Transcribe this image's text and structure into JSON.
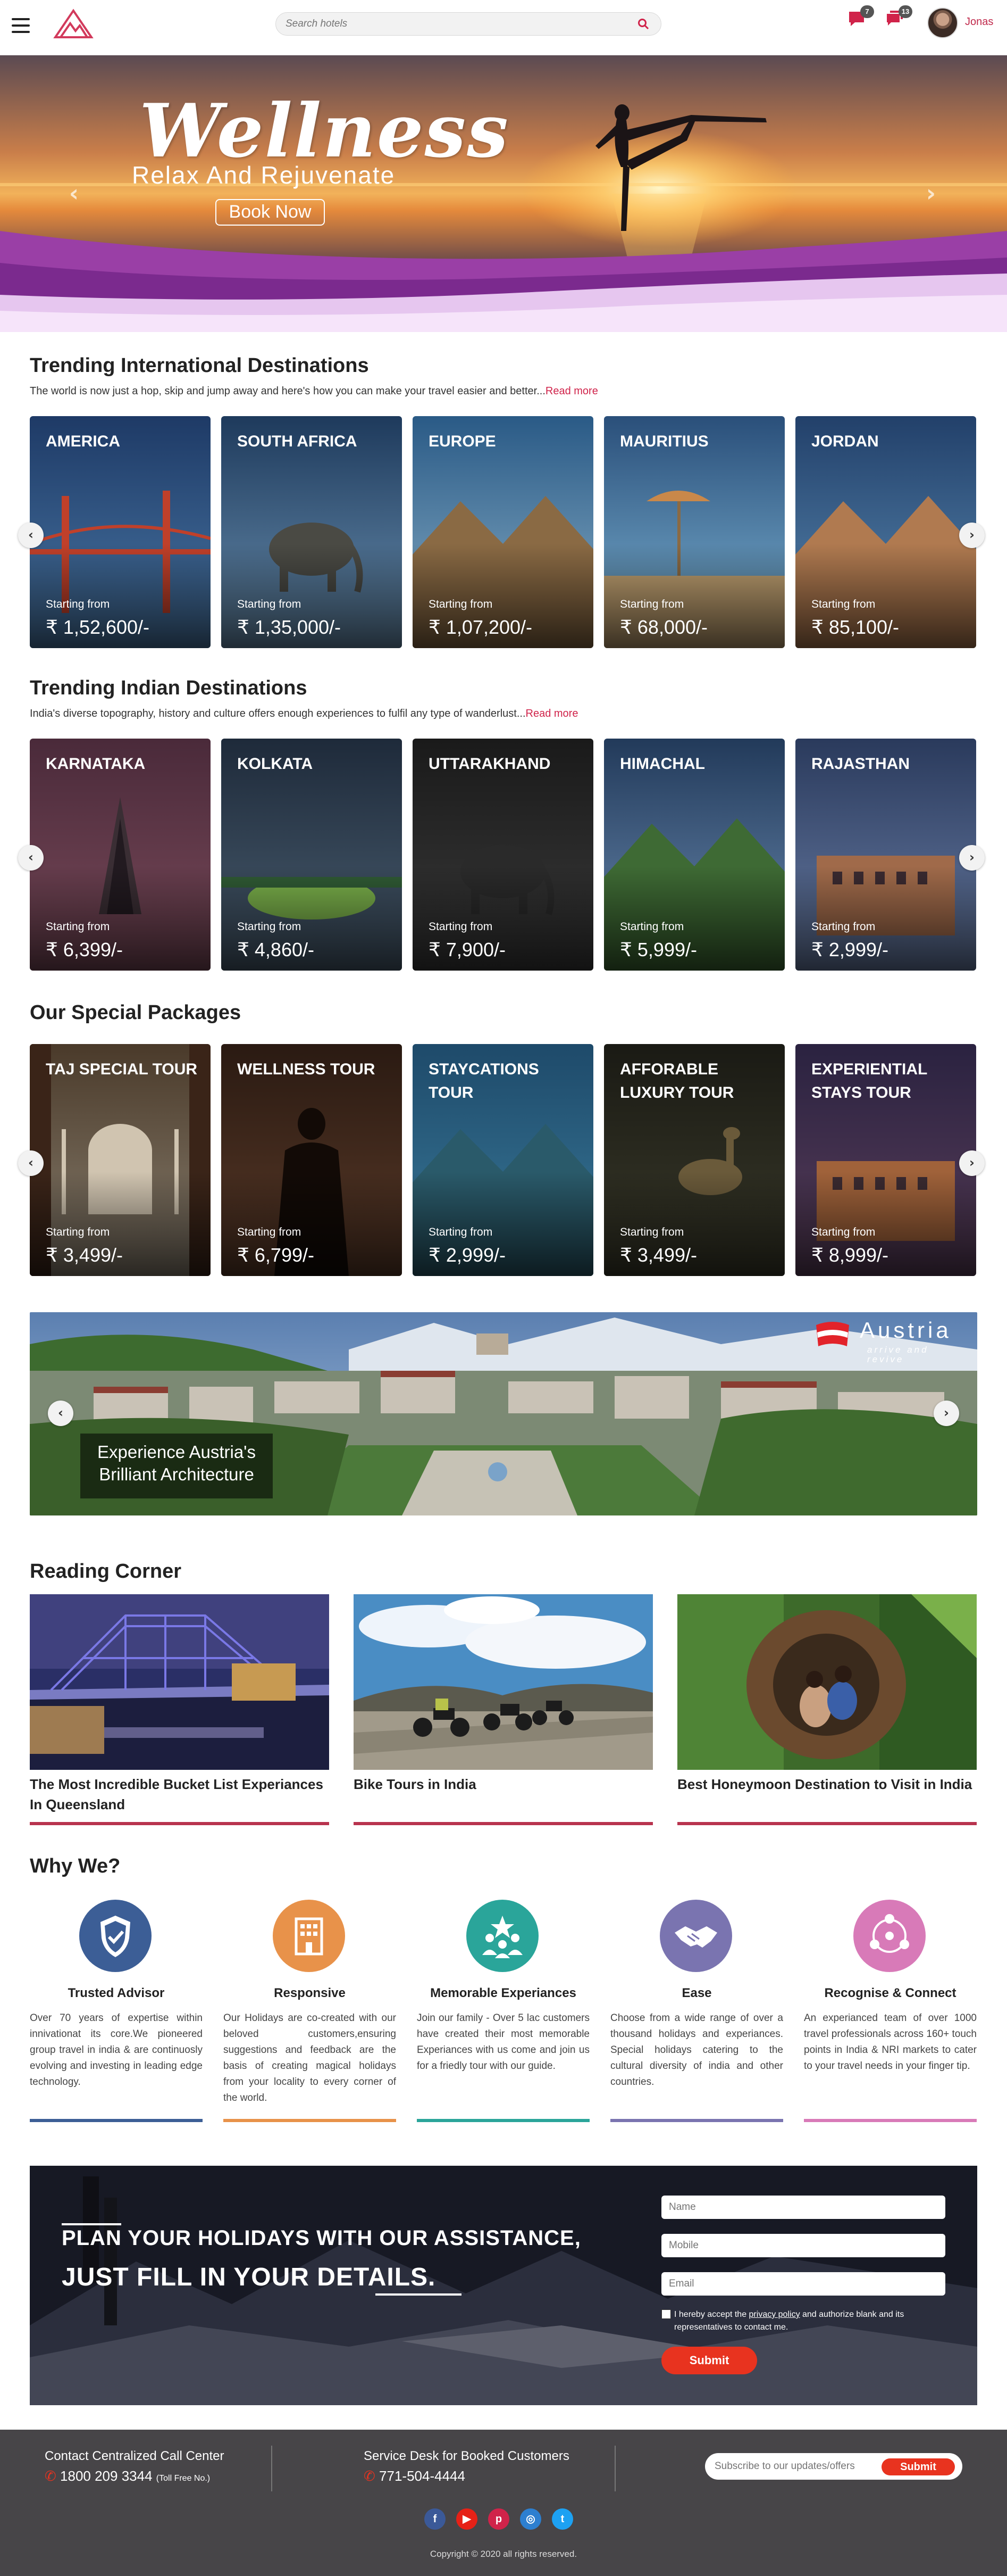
{
  "header": {
    "search_placeholder": "Search hotels",
    "chat_count": "7",
    "notif_count": "13",
    "user_name": "Jonas"
  },
  "hero": {
    "title": "Wellness",
    "subtitle": "Relax And Rejuvenate",
    "button": "Book Now"
  },
  "international": {
    "title": "Trending International Destinations",
    "desc": "The world is now just a hop, skip and jump away and here's how you can make your travel easier and better...",
    "read_more": "Read more",
    "cards": [
      {
        "name": "AMERICA",
        "from": "Starting from",
        "price": "₹ 1,52,600/-"
      },
      {
        "name": "SOUTH AFRICA",
        "from": "Starting from",
        "price": "₹ 1,35,000/-"
      },
      {
        "name": "EUROPE",
        "from": "Starting from",
        "price": "₹ 1,07,200/-"
      },
      {
        "name": "MAURITIUS",
        "from": "Starting from",
        "price": "₹ 68,000/-"
      },
      {
        "name": "JORDAN",
        "from": "Starting from",
        "price": "₹ 85,100/-"
      }
    ]
  },
  "indian": {
    "title": "Trending Indian Destinations",
    "desc": "India's diverse topography, history and culture offers enough experiences to fulfil any type of wanderlust...",
    "read_more": "Read more",
    "cards": [
      {
        "name": "KARNATAKA",
        "from": "Starting from",
        "price": "₹ 6,399/-"
      },
      {
        "name": "KOLKATA",
        "from": "Starting from",
        "price": "₹ 4,860/-"
      },
      {
        "name": "UTTARAKHAND",
        "from": "Starting from",
        "price": "₹ 7,900/-"
      },
      {
        "name": "HIMACHAL",
        "from": "Starting from",
        "price": "₹ 5,999/-"
      },
      {
        "name": "RAJASTHAN",
        "from": "Starting from",
        "price": "₹ 2,999/-"
      }
    ]
  },
  "packages": {
    "title": "Our Special Packages",
    "cards": [
      {
        "name": "TAJ SPECIAL TOUR",
        "from": "Starting from",
        "price": "₹ 3,499/-"
      },
      {
        "name": "WELLNESS TOUR",
        "from": "Starting from",
        "price": "₹ 6,799/-"
      },
      {
        "name": "STAYCATIONS TOUR",
        "from": "Starting from",
        "price": "₹ 2,999/-"
      },
      {
        "name": "AFFORABLE LUXURY TOUR",
        "from": "Starting from",
        "price": "₹ 3,499/-"
      },
      {
        "name": "EXPERIENTIAL STAYS TOUR",
        "from": "Starting from",
        "price": "₹ 8,999/-"
      }
    ]
  },
  "austria": {
    "caption": "Experience Austria's Brilliant Architecture",
    "brand": "Austria",
    "tagline": "arrive and revive"
  },
  "reading": {
    "title": "Reading Corner",
    "items": [
      {
        "title": "The Most Incredible Bucket List Experiances In Queensland"
      },
      {
        "title": "Bike Tours in India"
      },
      {
        "title": "Best Honeymoon Destination to Visit in India"
      }
    ]
  },
  "why": {
    "title": "Why We?",
    "items": [
      {
        "title": "Trusted Advisor",
        "desc": "Over 70 years of expertise within innivationat its core.We pioneered group travel in india & are continuosly evolving and investing in leading edge technology.",
        "color": "#3c5e96"
      },
      {
        "title": "Responsive",
        "desc": "Our Holidays are co-created with our beloved customers,ensuring suggestions and feedback are the basis of creating magical holidays from your locality to every corner of the world.",
        "color": "#e8924a"
      },
      {
        "title": "Memorable Experiances",
        "desc": "Join our family - Over 5 lac customers have created their most memorable Experiances with us come and join us for a friedly tour with our guide.",
        "color": "#2aa59a"
      },
      {
        "title": "Ease",
        "desc": "Choose from a wide range of over a thousand holidays and experiances. Special holidays catering to the cultural diversity of india and other countries.",
        "color": "#7a74b0"
      },
      {
        "title": "Recognise & Connect",
        "desc": "An experianced team of over 1000 travel professionals across 160+ touch points in India & NRI markets to cater to your travel needs in your finger tip.",
        "color": "#d87ab8"
      }
    ]
  },
  "plan": {
    "line1": "PLAN YOUR HOLIDAYS WITH OUR ASSISTANCE,",
    "line2": "JUST FILL IN YOUR DETAILS.",
    "name_ph": "Name",
    "mobile_ph": "Mobile",
    "email_ph": "Email",
    "consent_pre": "I hereby accept the ",
    "consent_link": "privacy policy",
    "consent_post": " and authorize blank and its representatives to contact me.",
    "submit": "Submit"
  },
  "footer": {
    "call_label": "Contact Centralized Call Center",
    "call_number": "1800 209 3344",
    "call_note": "(Toll Free No.)",
    "desk_label": "Service Desk for Booked Customers",
    "desk_number": "771-504-4444",
    "newsletter_ph": "Subscribe to our updates/offers",
    "newsletter_btn": "Submit",
    "copyright": "Copyright © 2020 all rights reserved."
  },
  "colors": {
    "accent": "#c0294b",
    "submit": "#e8331f",
    "footer_bg": "#474548"
  }
}
